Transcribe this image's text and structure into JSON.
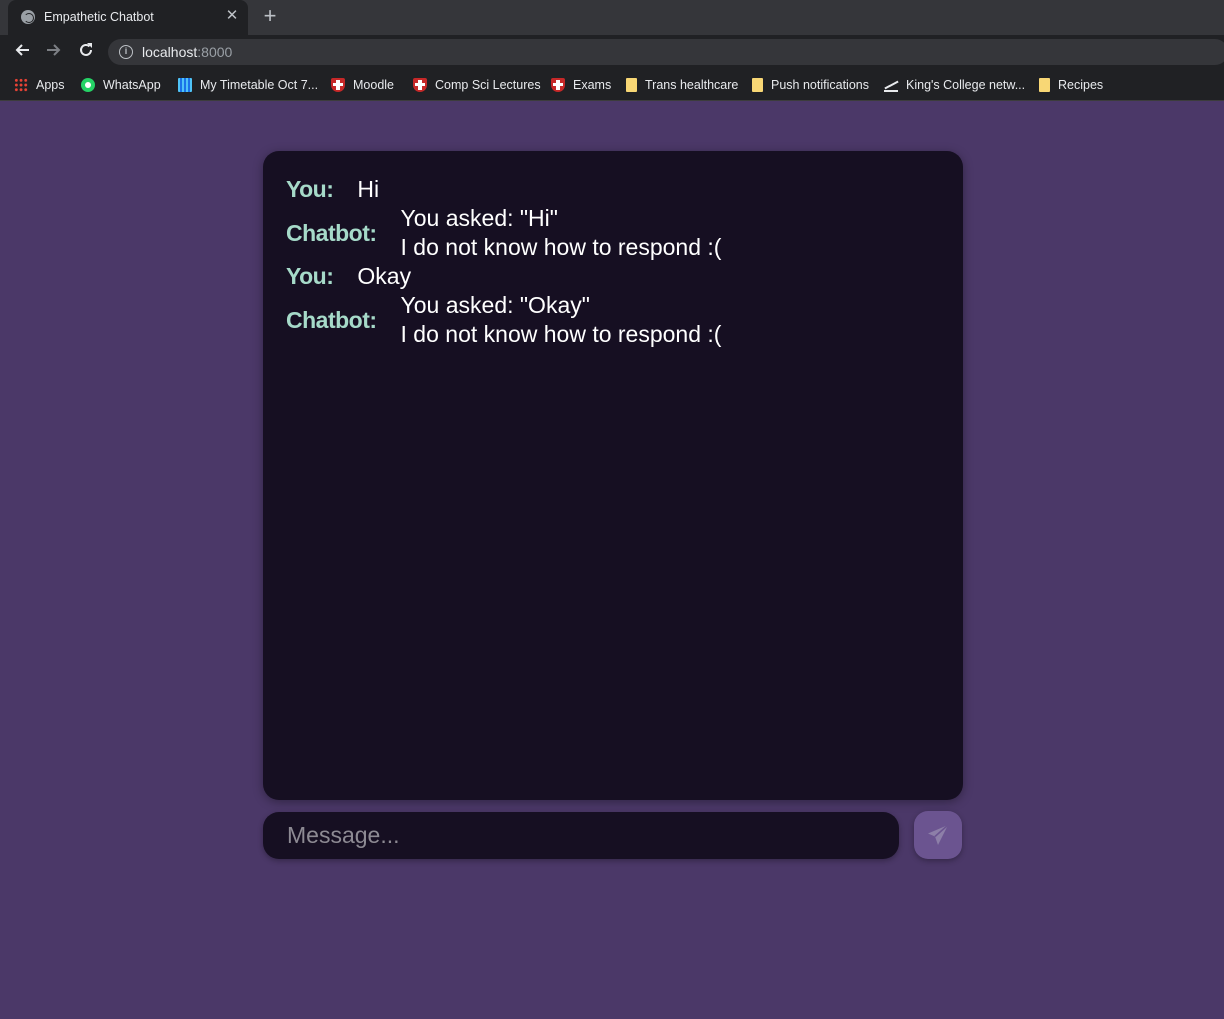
{
  "browser": {
    "tab_title": "Empathetic Chatbot",
    "tab_close": "✕",
    "new_tab": "+",
    "url_host": "localhost",
    "url_port": ":8000",
    "bookmarks": [
      {
        "label": "Apps",
        "icon": "apps-grid-icon"
      },
      {
        "label": "WhatsApp",
        "icon": "whatsapp-icon"
      },
      {
        "label": "My Timetable Oct 7...",
        "icon": "calendar-icon"
      },
      {
        "label": "Moodle",
        "icon": "crest-icon"
      },
      {
        "label": "Comp Sci Lectures",
        "icon": "crest-icon"
      },
      {
        "label": "Exams",
        "icon": "crest-icon"
      },
      {
        "label": "Trans healthcare",
        "icon": "folder-icon"
      },
      {
        "label": "Push notifications",
        "icon": "folder-icon"
      },
      {
        "label": "King's College netw...",
        "icon": "kings-icon"
      },
      {
        "label": "Recipes",
        "icon": "folder-icon"
      }
    ]
  },
  "chat": {
    "messages": [
      {
        "sender": "You:",
        "lines": [
          "Hi"
        ]
      },
      {
        "sender": "Chatbot:",
        "lines": [
          "You asked: \"Hi\"",
          "I do not know how to respond :("
        ]
      },
      {
        "sender": "You:",
        "lines": [
          "Okay"
        ]
      },
      {
        "sender": "Chatbot:",
        "lines": [
          "You asked: \"Okay\"",
          "I do not know how to respond :("
        ]
      }
    ],
    "input_placeholder": "Message...",
    "input_value": ""
  },
  "colors": {
    "page_background": "#4b3868",
    "panel_background": "#160f22",
    "sender_label": "#a6dac9",
    "send_button": "#6b5490"
  }
}
